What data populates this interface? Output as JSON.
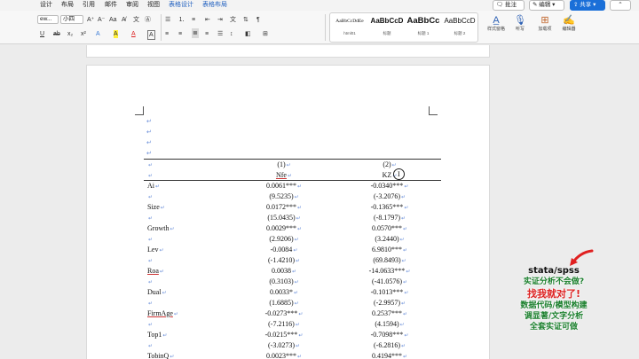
{
  "ribbon": {
    "tabs": [
      "设计",
      "布局",
      "引用",
      "邮件",
      "审阅",
      "视图",
      "表格设计",
      "表格布局"
    ],
    "comment_button": "批注",
    "edit_button": "编辑",
    "share_button": "共享",
    "font_name": "ew...",
    "font_size": "小四",
    "format_buttons": [
      "U",
      "ab",
      "x₂",
      "x²",
      "A",
      "A",
      "A",
      "A"
    ],
    "styles": [
      {
        "sample": "AaBbCcDdEe",
        "name": "html01"
      },
      {
        "sample": "AaBbCcD",
        "name": "标题"
      },
      {
        "sample": "AaBbCc",
        "name": "标题 1"
      },
      {
        "sample": "AaBbCcD",
        "name": "标题 2"
      }
    ],
    "right_tools": [
      {
        "label": "样式窗格",
        "icon": "styles-pane-icon"
      },
      {
        "label": "听写",
        "icon": "microphone-icon"
      },
      {
        "label": "加载项",
        "icon": "addins-icon"
      },
      {
        "label": "编辑器",
        "icon": "editor-icon"
      }
    ]
  },
  "table": {
    "headers": [
      {
        "label": "",
        "m1": "(1)",
        "m2": "(2)"
      },
      {
        "label": "",
        "m1": "Nfe",
        "m2": "KZ"
      }
    ],
    "rows": [
      {
        "label": "Ai",
        "m1": "0.0061***",
        "m2": "-0.0340***"
      },
      {
        "label": "",
        "m1": "(9.5235)",
        "m2": "(-3.2076)"
      },
      {
        "label": "Size",
        "m1": "0.0172***",
        "m2": "-0.1365***"
      },
      {
        "label": "",
        "m1": "(15.0435)",
        "m2": "(-8.1797)"
      },
      {
        "label": "Growth",
        "m1": "0.0029***",
        "m2": "0.0570***"
      },
      {
        "label": "",
        "m1": "(2.9206)",
        "m2": "(3.2440)"
      },
      {
        "label": "Lev",
        "m1": "-0.0084",
        "m2": "6.9810***"
      },
      {
        "label": "",
        "m1": "(-1.4210)",
        "m2": "(69.8493)"
      },
      {
        "label": "Roa",
        "m1": "0.0038",
        "m2": "-14.0633***"
      },
      {
        "label": "",
        "m1": "(0.3103)",
        "m2": "(-41.0576)"
      },
      {
        "label": "Dual",
        "m1": "0.0033*",
        "m2": "-0.1013***"
      },
      {
        "label": "",
        "m1": "(1.6885)",
        "m2": "(-2.9957)"
      },
      {
        "label": "FirmAge",
        "m1": "-0.0273***",
        "m2": "0.2537***"
      },
      {
        "label": "",
        "m1": "(-7.2116)",
        "m2": "(4.1594)"
      },
      {
        "label": "Top1",
        "m1": "-0.0215***",
        "m2": "-0.7098***"
      },
      {
        "label": "",
        "m1": "(-3.0273)",
        "m2": "(-6.2816)"
      },
      {
        "label": "TobinQ",
        "m1": "0.0023***",
        "m2": "0.4194***"
      }
    ],
    "underlined_labels": [
      "Roa",
      "FirmAge"
    ]
  },
  "overlay": {
    "title": "stata/spss",
    "lines": [
      "实证分析不会做?",
      "找我就对了!",
      "数据代码/模型构建",
      "调显著/文字分析",
      "全套实证可做"
    ]
  },
  "colors": {
    "accent": "#1a6fd8",
    "paragraph_mark": "#6a8ed9",
    "ad_red": "#d22222",
    "ad_green": "#1a7f2c"
  }
}
